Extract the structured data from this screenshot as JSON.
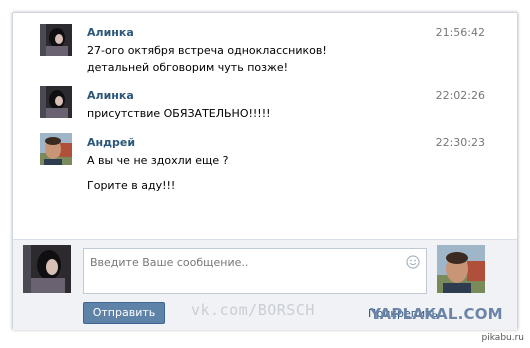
{
  "messages": [
    {
      "author": "Алинка",
      "time": "21:56:42",
      "lines": [
        "27-ого октября встреча одноклассников!",
        "детальней обговорим чуть позже!"
      ],
      "avatar": "alinka-avatar"
    },
    {
      "author": "Алинка",
      "time": "22:02:26",
      "lines": [
        "присутствие ОБЯЗАТЕЛЬНО!!!!!"
      ],
      "avatar": "alinka-avatar"
    },
    {
      "author": "Андрей",
      "time": "22:30:23",
      "lines": [
        "А вы че не здохли еще ?",
        "Горите в аду!!!"
      ],
      "avatar": "andrey-avatar"
    }
  ],
  "composer": {
    "placeholder": "Введите Ваше сообщение..",
    "send_label": "Отправить",
    "attach_label": "Прикрепить",
    "emoji_icon": "smile-icon"
  },
  "watermarks": {
    "vk": "vk.com/BORSCH",
    "yaplakal": "YAPLAKAL.COM",
    "pikabu": "pikabu.ru"
  },
  "colors": {
    "author": "#2b587a",
    "button": "#5e82a8",
    "bottom_bg": "#f0f2f5"
  }
}
